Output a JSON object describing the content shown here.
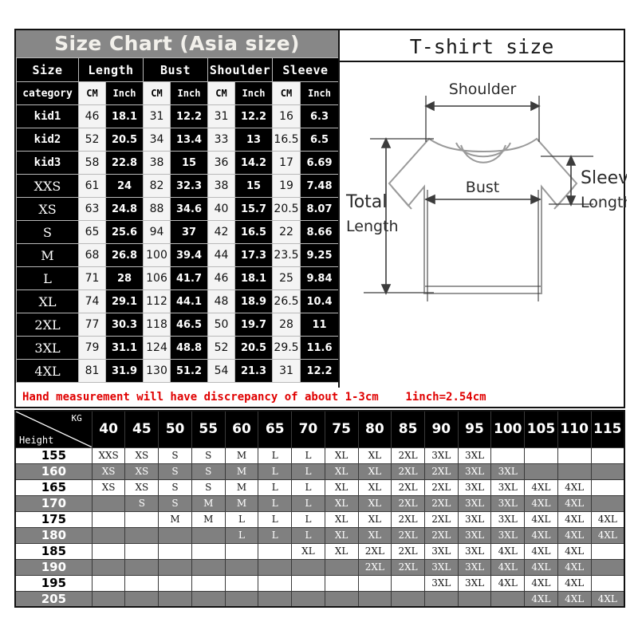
{
  "header": {
    "title": "Size Chart (Asia size)",
    "title_bg": "#878787",
    "title_color": "#f2f0eb"
  },
  "size_table": {
    "group_headers": [
      "Size",
      "Length",
      "Bust",
      "Shoulder",
      "Sleeve"
    ],
    "unit_row": [
      "category",
      "CM",
      "Inch",
      "CM",
      "Inch",
      "CM",
      "Inch",
      "CM",
      "Inch"
    ],
    "rows": [
      {
        "size": "kid1",
        "length_cm": "46",
        "length_in": "18.1",
        "bust_cm": "31",
        "bust_in": "12.2",
        "shoulder_cm": "31",
        "shoulder_in": "12.2",
        "sleeve_cm": "16",
        "sleeve_in": "6.3"
      },
      {
        "size": "kid2",
        "length_cm": "52",
        "length_in": "20.5",
        "bust_cm": "34",
        "bust_in": "13.4",
        "shoulder_cm": "33",
        "shoulder_in": "13",
        "sleeve_cm": "16.5",
        "sleeve_in": "6.5"
      },
      {
        "size": "kid3",
        "length_cm": "58",
        "length_in": "22.8",
        "bust_cm": "38",
        "bust_in": "15",
        "shoulder_cm": "36",
        "shoulder_in": "14.2",
        "sleeve_cm": "17",
        "sleeve_in": "6.69"
      },
      {
        "size": "XXS",
        "length_cm": "61",
        "length_in": "24",
        "bust_cm": "82",
        "bust_in": "32.3",
        "shoulder_cm": "38",
        "shoulder_in": "15",
        "sleeve_cm": "19",
        "sleeve_in": "7.48"
      },
      {
        "size": "XS",
        "length_cm": "63",
        "length_in": "24.8",
        "bust_cm": "88",
        "bust_in": "34.6",
        "shoulder_cm": "40",
        "shoulder_in": "15.7",
        "sleeve_cm": "20.5",
        "sleeve_in": "8.07"
      },
      {
        "size": "S",
        "length_cm": "65",
        "length_in": "25.6",
        "bust_cm": "94",
        "bust_in": "37",
        "shoulder_cm": "42",
        "shoulder_in": "16.5",
        "sleeve_cm": "22",
        "sleeve_in": "8.66"
      },
      {
        "size": "M",
        "length_cm": "68",
        "length_in": "26.8",
        "bust_cm": "100",
        "bust_in": "39.4",
        "shoulder_cm": "44",
        "shoulder_in": "17.3",
        "sleeve_cm": "23.5",
        "sleeve_in": "9.25"
      },
      {
        "size": "L",
        "length_cm": "71",
        "length_in": "28",
        "bust_cm": "106",
        "bust_in": "41.7",
        "shoulder_cm": "46",
        "shoulder_in": "18.1",
        "sleeve_cm": "25",
        "sleeve_in": "9.84"
      },
      {
        "size": "XL",
        "length_cm": "74",
        "length_in": "29.1",
        "bust_cm": "112",
        "bust_in": "44.1",
        "shoulder_cm": "48",
        "shoulder_in": "18.9",
        "sleeve_cm": "26.5",
        "sleeve_in": "10.4"
      },
      {
        "size": "2XL",
        "length_cm": "77",
        "length_in": "30.3",
        "bust_cm": "118",
        "bust_in": "46.5",
        "shoulder_cm": "50",
        "shoulder_in": "19.7",
        "sleeve_cm": "28",
        "sleeve_in": "11"
      },
      {
        "size": "3XL",
        "length_cm": "79",
        "length_in": "31.1",
        "bust_cm": "124",
        "bust_in": "48.8",
        "shoulder_cm": "52",
        "shoulder_in": "20.5",
        "sleeve_cm": "29.5",
        "sleeve_in": "11.6"
      },
      {
        "size": "4XL",
        "length_cm": "81",
        "length_in": "31.9",
        "bust_cm": "130",
        "bust_in": "51.2",
        "shoulder_cm": "54",
        "shoulder_in": "21.3",
        "sleeve_cm": "31",
        "sleeve_in": "12.2"
      }
    ]
  },
  "diagram": {
    "title": "T-shirt size",
    "labels": {
      "shoulder": "Shoulder",
      "bust": "Bust",
      "total": "Total",
      "length": "Length",
      "sleeve": "Sleeve",
      "longth": "Longth"
    }
  },
  "note": {
    "text": "Hand measurement will have discrepancy of about 1-3cm    1inch=2.54cm",
    "color": "#e00000"
  },
  "fit_table": {
    "corner": {
      "kg": "KG",
      "height": "Height"
    },
    "weights": [
      "40",
      "45",
      "50",
      "55",
      "60",
      "65",
      "70",
      "75",
      "80",
      "85",
      "90",
      "95",
      "100",
      "105",
      "110",
      "115"
    ],
    "rows": [
      {
        "height": "155",
        "sizes": [
          "XXS",
          "XS",
          "S",
          "S",
          "M",
          "L",
          "L",
          "XL",
          "XL",
          "2XL",
          "3XL",
          "3XL",
          "",
          "",
          "",
          ""
        ]
      },
      {
        "height": "160",
        "sizes": [
          "XS",
          "XS",
          "S",
          "S",
          "M",
          "L",
          "L",
          "XL",
          "XL",
          "2XL",
          "2XL",
          "3XL",
          "3XL",
          "",
          "",
          ""
        ]
      },
      {
        "height": "165",
        "sizes": [
          "XS",
          "XS",
          "S",
          "S",
          "M",
          "L",
          "L",
          "XL",
          "XL",
          "2XL",
          "2XL",
          "3XL",
          "3XL",
          "4XL",
          "4XL",
          ""
        ]
      },
      {
        "height": "170",
        "sizes": [
          "",
          "S",
          "S",
          "M",
          "M",
          "L",
          "L",
          "XL",
          "XL",
          "2XL",
          "2XL",
          "3XL",
          "3XL",
          "4XL",
          "4XL",
          ""
        ]
      },
      {
        "height": "175",
        "sizes": [
          "",
          "",
          "M",
          "M",
          "L",
          "L",
          "L",
          "XL",
          "XL",
          "2XL",
          "2XL",
          "3XL",
          "3XL",
          "4XL",
          "4XL",
          "4XL"
        ]
      },
      {
        "height": "180",
        "sizes": [
          "",
          "",
          "",
          "",
          "L",
          "L",
          "L",
          "XL",
          "XL",
          "2XL",
          "2XL",
          "3XL",
          "3XL",
          "4XL",
          "4XL",
          "4XL"
        ]
      },
      {
        "height": "185",
        "sizes": [
          "",
          "",
          "",
          "",
          "",
          "",
          "XL",
          "XL",
          "2XL",
          "2XL",
          "3XL",
          "3XL",
          "4XL",
          "4XL",
          "4XL",
          ""
        ]
      },
      {
        "height": "190",
        "sizes": [
          "",
          "",
          "",
          "",
          "",
          "",
          "",
          "",
          "2XL",
          "2XL",
          "3XL",
          "3XL",
          "4XL",
          "4XL",
          "4XL",
          ""
        ]
      },
      {
        "height": "195",
        "sizes": [
          "",
          "",
          "",
          "",
          "",
          "",
          "",
          "",
          "",
          "",
          "3XL",
          "3XL",
          "4XL",
          "4XL",
          "4XL",
          ""
        ]
      },
      {
        "height": "205",
        "sizes": [
          "",
          "",
          "",
          "",
          "",
          "",
          "",
          "",
          "",
          "",
          "",
          "",
          "",
          "4XL",
          "4XL",
          "4XL"
        ]
      }
    ]
  }
}
